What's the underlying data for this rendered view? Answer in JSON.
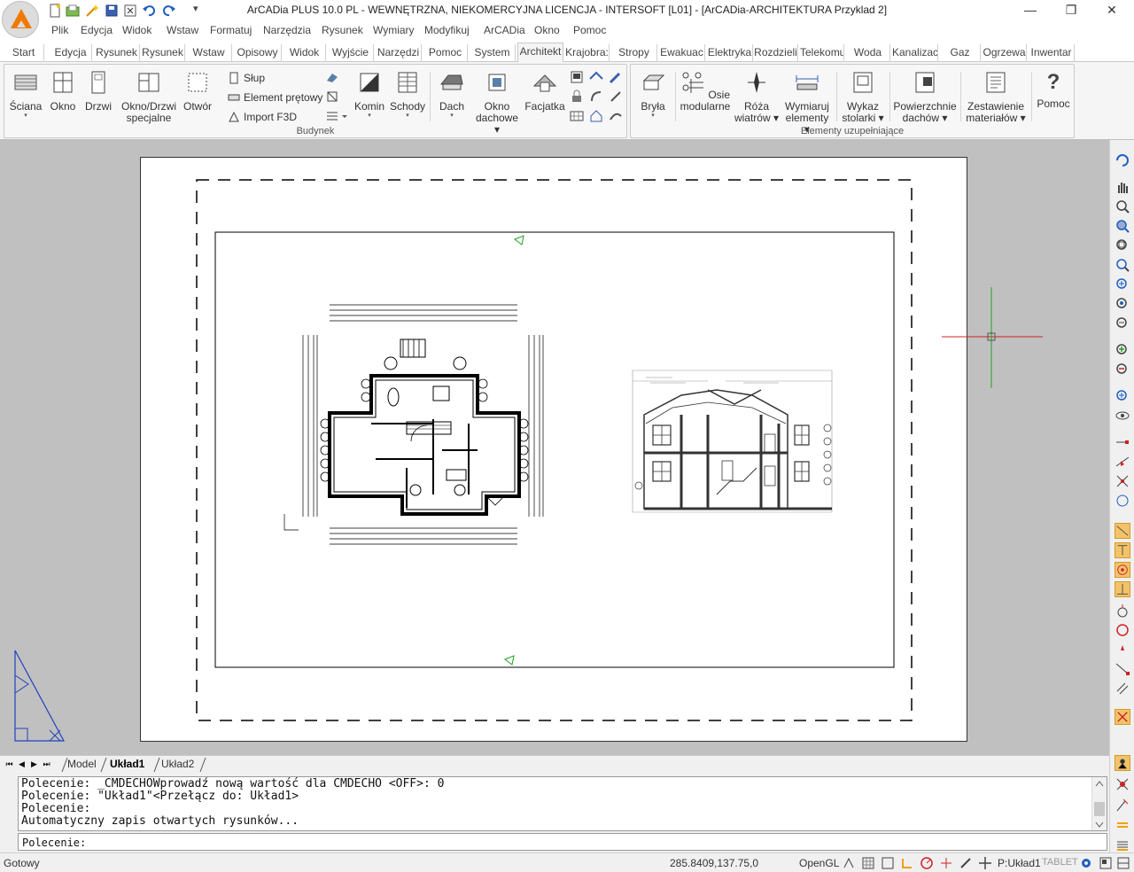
{
  "window": {
    "title": "ArCADia PLUS 10.0 PL - WEWNĘTRZNA, NIEKOMERCYJNA LICENCJA - INTERSOFT [L01] - [ArCADia-ARCHITEKTURA Przyklad 2]",
    "minimize": "—",
    "restore": "❐",
    "close": "✕",
    "qa_more": "▾"
  },
  "menu": [
    "Plik",
    "Edycja",
    "Widok",
    "Wstaw",
    "Formatuj",
    "Narzędzia",
    "Rysunek",
    "Wymiary",
    "Modyfikuj",
    "ArCADia",
    "Okno",
    "Pomoc"
  ],
  "ribbon_tabs": [
    "Start",
    "Edycja",
    "Rysunek",
    "Rysunek",
    "Wstaw",
    "Opisowy",
    "Widok",
    "Wyjście",
    "Narzędzi",
    "Pomoc",
    "System",
    "Architekt",
    "Krajobra:",
    "Stropy",
    "Ewakuac",
    "Elektryka",
    "Rozdzieli",
    "Telekomu",
    "Woda",
    "Kanalizac",
    "Gaz",
    "Ogrzewa",
    "Inwentar"
  ],
  "active_tab": "Architekt",
  "group_budynek": {
    "label": "Budynek",
    "big_buttons": [
      {
        "label": "Ściana",
        "caret": "▾"
      },
      {
        "label": "Okno"
      },
      {
        "label": "Drzwi"
      },
      {
        "label": "Okno/Drzwi",
        "label2": "specjalne"
      },
      {
        "label": "Otwór"
      }
    ],
    "small_buttons": [
      "Słup",
      "Element prętowy",
      "Import F3D"
    ],
    "big_buttons2": [
      {
        "label": "Komin",
        "caret": "▾"
      },
      {
        "label": "Schody",
        "caret": "▾"
      },
      {
        "label": "Dach",
        "caret": "▾"
      },
      {
        "label": "Okno",
        "label2": "dachowe ▾"
      },
      {
        "label": "Facjatka"
      }
    ]
  },
  "group_elementy": {
    "label": "Elementy uzupełniające",
    "buttons": [
      {
        "label": "Bryła",
        "caret": "▾"
      },
      {
        "label": "Osie",
        "label2": "modularne"
      },
      {
        "label": "Róża",
        "label2": "wiatrów ▾"
      },
      {
        "label": "Wymiaruj",
        "label2": "elementy ▾"
      },
      {
        "label": "Wykaz",
        "label2": "stolarki ▾"
      },
      {
        "label": "Powierzchnie",
        "label2": "dachów ▾"
      },
      {
        "label": "Zestawienie",
        "label2": "materiałów ▾"
      },
      {
        "label": "Pomoc"
      }
    ],
    "help_glyph": "?"
  },
  "layout_tabs": [
    "Model",
    "Układ1",
    "Układ2"
  ],
  "active_layout": "Układ1",
  "nav": [
    "⏮",
    "◀",
    "▶",
    "⏭"
  ],
  "command_history": [
    "Polecenie: _CMDECHOWprowadź nową wartość dla CMDECHO <OFF>: 0",
    "Polecenie: \"Układ1\"<Przełącz do: Układ1>",
    "Polecenie:",
    "Automatyczny zapis otwartych rysunków..."
  ],
  "command_prompt": "Polecenie:",
  "status": {
    "ready": "Gotowy",
    "coords": "285.8409,137.75,0",
    "renderer": "OpenGL",
    "space": "P:Układ1",
    "tablet": "TABLET"
  },
  "colors": {
    "accent_orange": "#f07a00",
    "workspace_bg": "#c0c0c0",
    "ucs_blue": "#2040c0",
    "cursor_red": "#d02020",
    "cursor_green": "#20a020"
  }
}
